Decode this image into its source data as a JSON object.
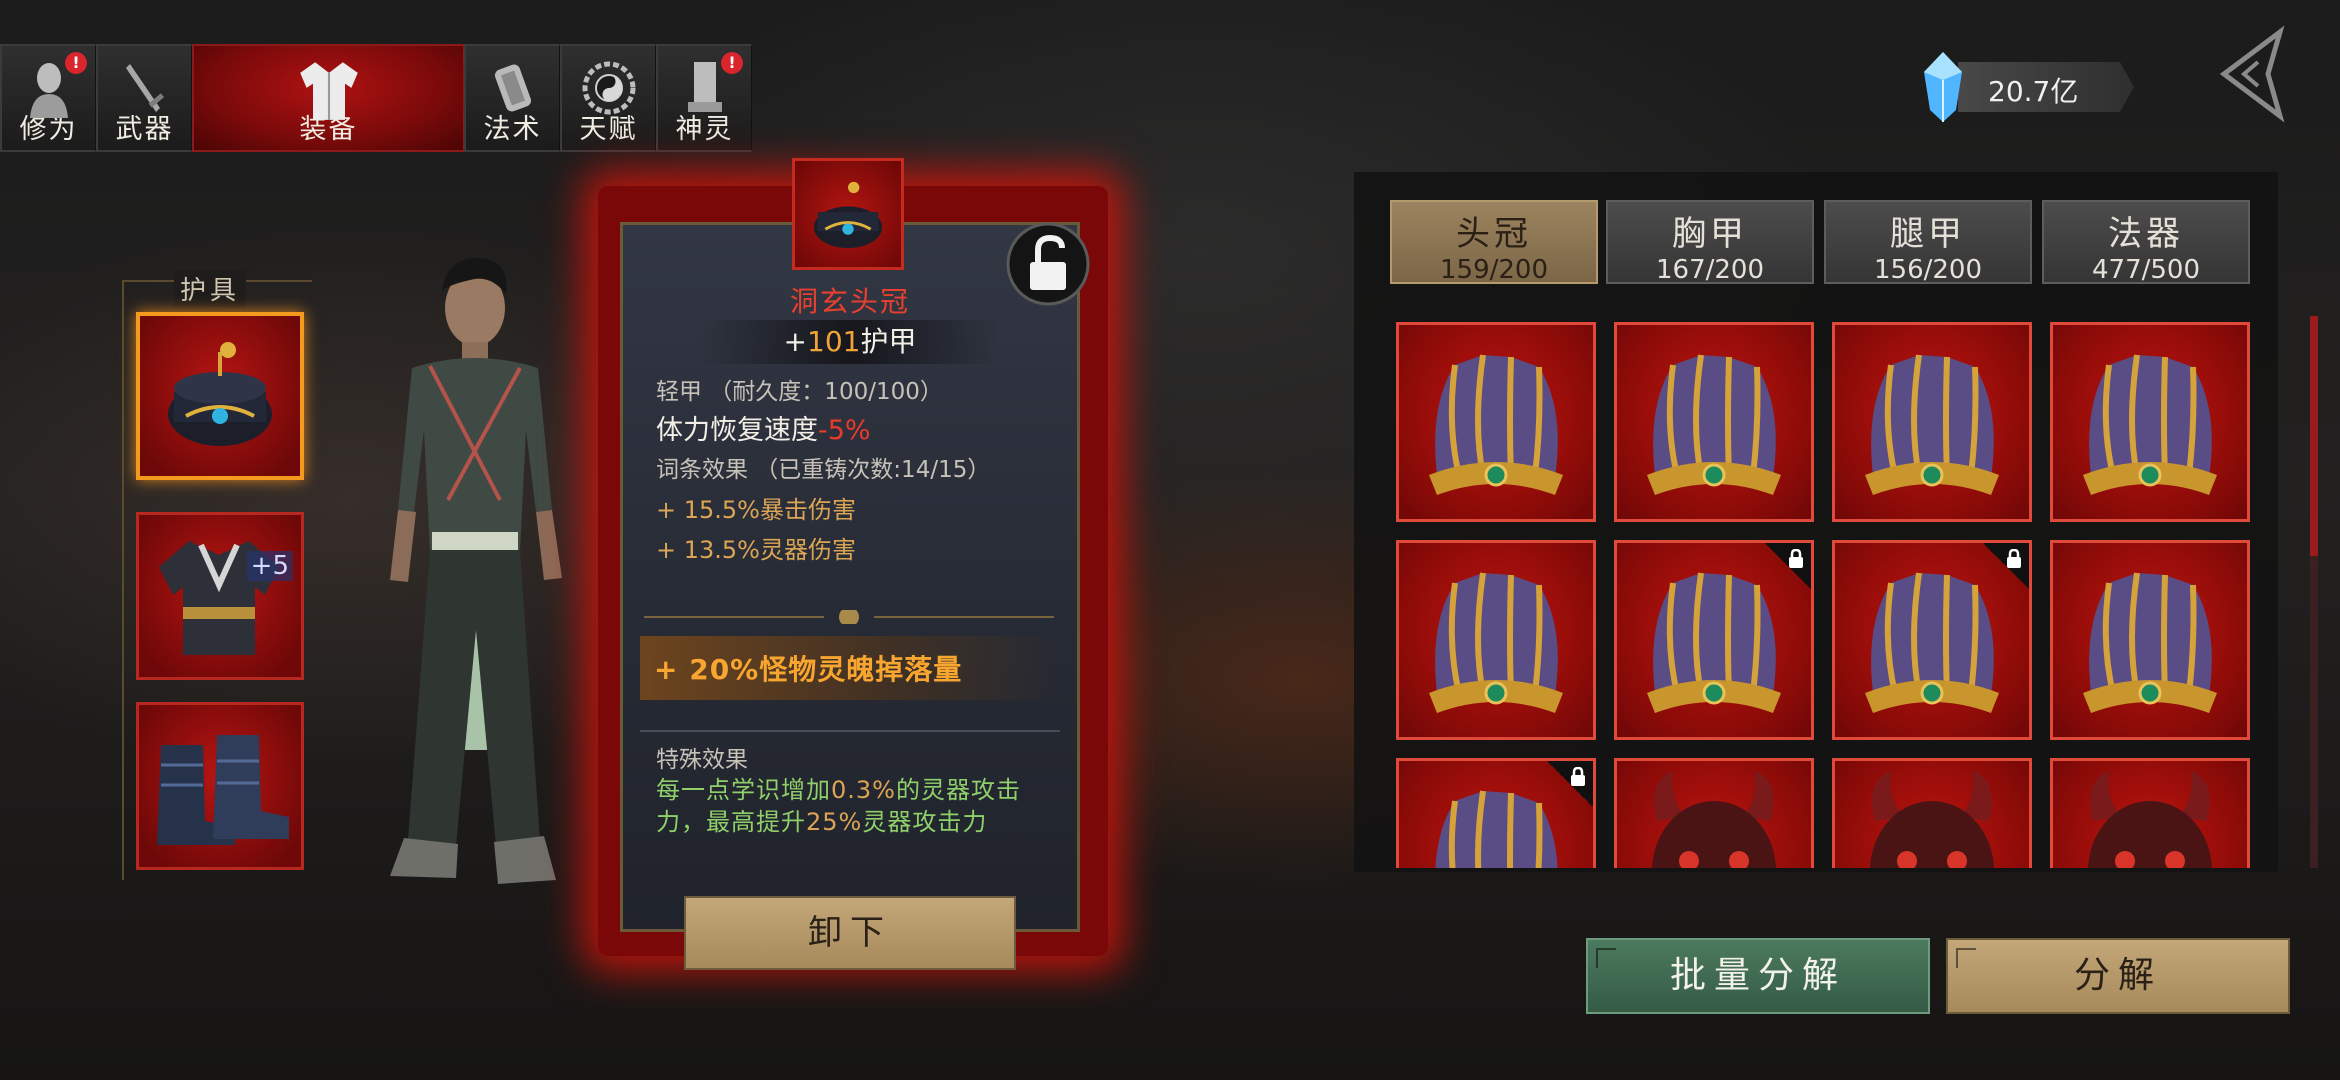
{
  "top_tabs": [
    {
      "label": "修为",
      "icon": "figure-icon",
      "badge": "!"
    },
    {
      "label": "武器",
      "icon": "sword-icon",
      "badge": ""
    },
    {
      "label": "装备",
      "icon": "robe-icon",
      "badge": "",
      "active": true
    },
    {
      "label": "法术",
      "icon": "scroll-icon",
      "badge": ""
    },
    {
      "label": "天赋",
      "icon": "bagua-icon",
      "badge": ""
    },
    {
      "label": "神灵",
      "icon": "tablet-icon",
      "badge": "!"
    }
  ],
  "currency": {
    "amount": "20.7亿",
    "icon": "crystal-gem-icon"
  },
  "armor_section": {
    "title": "护具",
    "slots": [
      {
        "item": "headgear",
        "selected": true
      },
      {
        "item": "chest-armor",
        "enhance": "+5"
      },
      {
        "item": "boots"
      }
    ]
  },
  "item_detail": {
    "name": "洞玄头冠",
    "armor_prefix": "+",
    "armor_value": "101",
    "armor_suffix": "护甲",
    "type_line": "轻甲 （耐久度：100/100）",
    "stamina_label": "体力恢复速度",
    "stamina_value": "-5%",
    "affix_header": "词条效果 （已重铸次数:14/15）",
    "affixes": [
      "+ 15.5%暴击伤害",
      "+ 13.5%灵器伤害"
    ],
    "bonus": "+ 20%怪物灵魄掉落量",
    "special_header": "特殊效果",
    "special_parts": [
      "每一点学识增加",
      "0.3%",
      "的灵器攻击力，最高提升",
      "25%",
      "灵器攻击力"
    ],
    "unequip_label": "卸下",
    "lock_icon": "unlock-icon"
  },
  "inventory": {
    "tabs": [
      {
        "name": "头冠",
        "count": "159/200",
        "active": true
      },
      {
        "name": "胸甲",
        "count": "167/200"
      },
      {
        "name": "腿甲",
        "count": "156/200"
      },
      {
        "name": "法器",
        "count": "477/500"
      }
    ],
    "items": [
      {
        "kind": "crown",
        "locked": false
      },
      {
        "kind": "crown",
        "locked": false
      },
      {
        "kind": "crown",
        "locked": false
      },
      {
        "kind": "crown",
        "locked": false
      },
      {
        "kind": "crown",
        "locked": false
      },
      {
        "kind": "crown",
        "locked": true
      },
      {
        "kind": "crown",
        "locked": true
      },
      {
        "kind": "crown",
        "locked": false
      },
      {
        "kind": "crown",
        "locked": true
      },
      {
        "kind": "demon-mask",
        "locked": false
      },
      {
        "kind": "demon-mask",
        "locked": false
      },
      {
        "kind": "demon-mask",
        "locked": false
      }
    ]
  },
  "actions": {
    "batch_label": "批量分解",
    "single_label": "分解"
  },
  "colors": {
    "accent_red": "#b01212",
    "gold": "#c4a779",
    "green_btn": "#4c7a5e",
    "bonus_orange": "#f8a630"
  }
}
